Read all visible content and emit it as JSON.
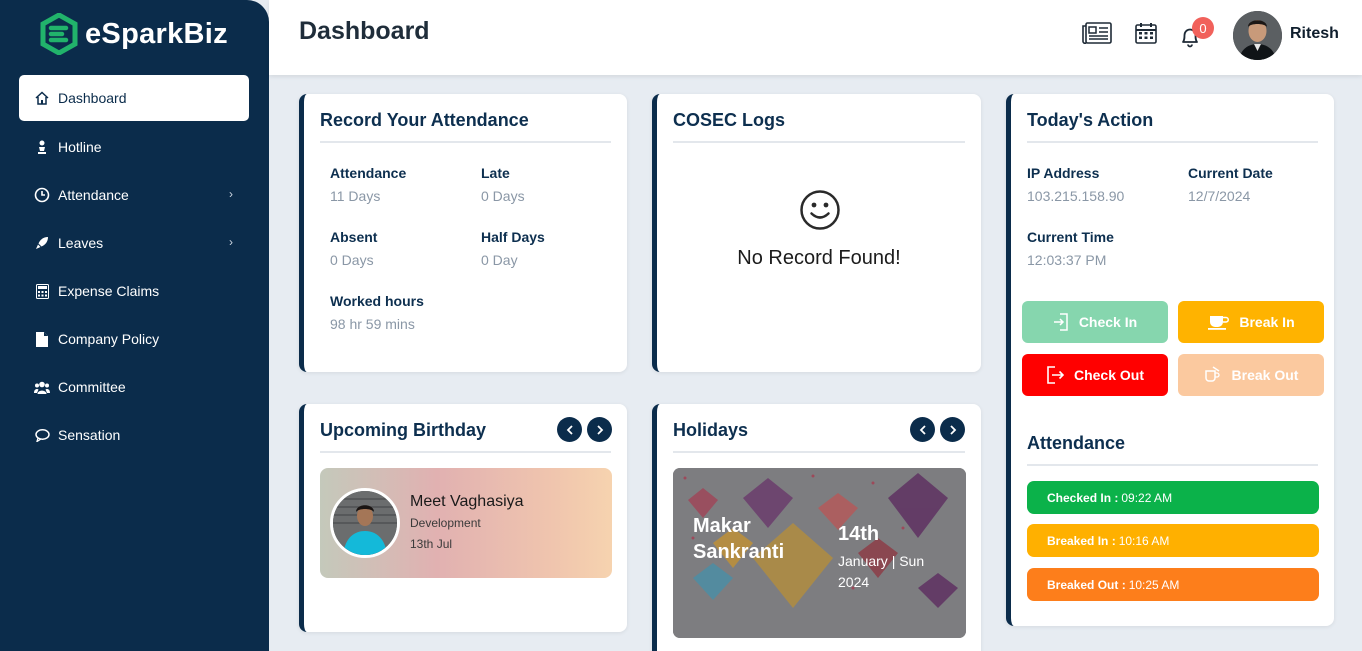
{
  "brand": {
    "name": "eSparkBiz",
    "accent": "#21b36b"
  },
  "sidebar": {
    "items": [
      {
        "label": "Dashboard",
        "icon": "home-icon",
        "active": true
      },
      {
        "label": "Hotline",
        "icon": "person-icon"
      },
      {
        "label": "Attendance",
        "icon": "clock-icon",
        "has_submenu": true
      },
      {
        "label": "Leaves",
        "icon": "rocket-icon",
        "has_submenu": true
      },
      {
        "label": "Expense Claims",
        "icon": "calculator-icon"
      },
      {
        "label": "Company Policy",
        "icon": "file-icon"
      },
      {
        "label": "Committee",
        "icon": "users-icon"
      },
      {
        "label": "Sensation",
        "icon": "chat-icon"
      }
    ]
  },
  "header": {
    "title": "Dashboard",
    "notification_count": "0",
    "user_name": "Ritesh"
  },
  "attendance_card": {
    "title": "Record Your Attendance",
    "stats": [
      {
        "label": "Attendance",
        "value": "11 Days"
      },
      {
        "label": "Late",
        "value": "0 Days"
      },
      {
        "label": "Absent",
        "value": "0 Days"
      },
      {
        "label": "Half Days",
        "value": "0 Day"
      },
      {
        "label": "Worked hours",
        "value": "98 hr 59 mins"
      }
    ]
  },
  "cosec_card": {
    "title": "COSEC Logs",
    "empty_icon": "smiley-icon",
    "empty_text": "No Record Found!"
  },
  "today_card": {
    "title": "Today's Action",
    "fields": [
      {
        "label": "IP Address",
        "value": "103.215.158.90"
      },
      {
        "label": "Current Date",
        "value": "12/7/2024"
      },
      {
        "label": "Current Time",
        "value": "12:03:37 PM"
      }
    ],
    "buttons": [
      {
        "label": "Check In",
        "color": "#86d6ae",
        "enabled": false
      },
      {
        "label": "Break In",
        "color": "#ffb300",
        "enabled": true
      },
      {
        "label": "Check Out",
        "color": "#ff0000",
        "enabled": true
      },
      {
        "label": "Break Out",
        "color": "#fbc99f",
        "enabled": false
      }
    ],
    "attendance_title": "Attendance",
    "log": [
      {
        "label": "Checked In :",
        "time": "09:22 AM",
        "color": "#0bb24a"
      },
      {
        "label": "Breaked In :",
        "time": "10:16 AM",
        "color": "#ffb000"
      },
      {
        "label": "Breaked Out :",
        "time": "10:25 AM",
        "color": "#fd7e1b"
      }
    ]
  },
  "birthday_card": {
    "title": "Upcoming Birthday",
    "person": {
      "name": "Meet Vaghasiya",
      "department": "Development",
      "date": "13th Jul"
    }
  },
  "holidays_card": {
    "title": "Holidays",
    "holiday": {
      "name": "Makar Sankranti",
      "day": "14th",
      "detail": "January | Sun 2024"
    }
  }
}
